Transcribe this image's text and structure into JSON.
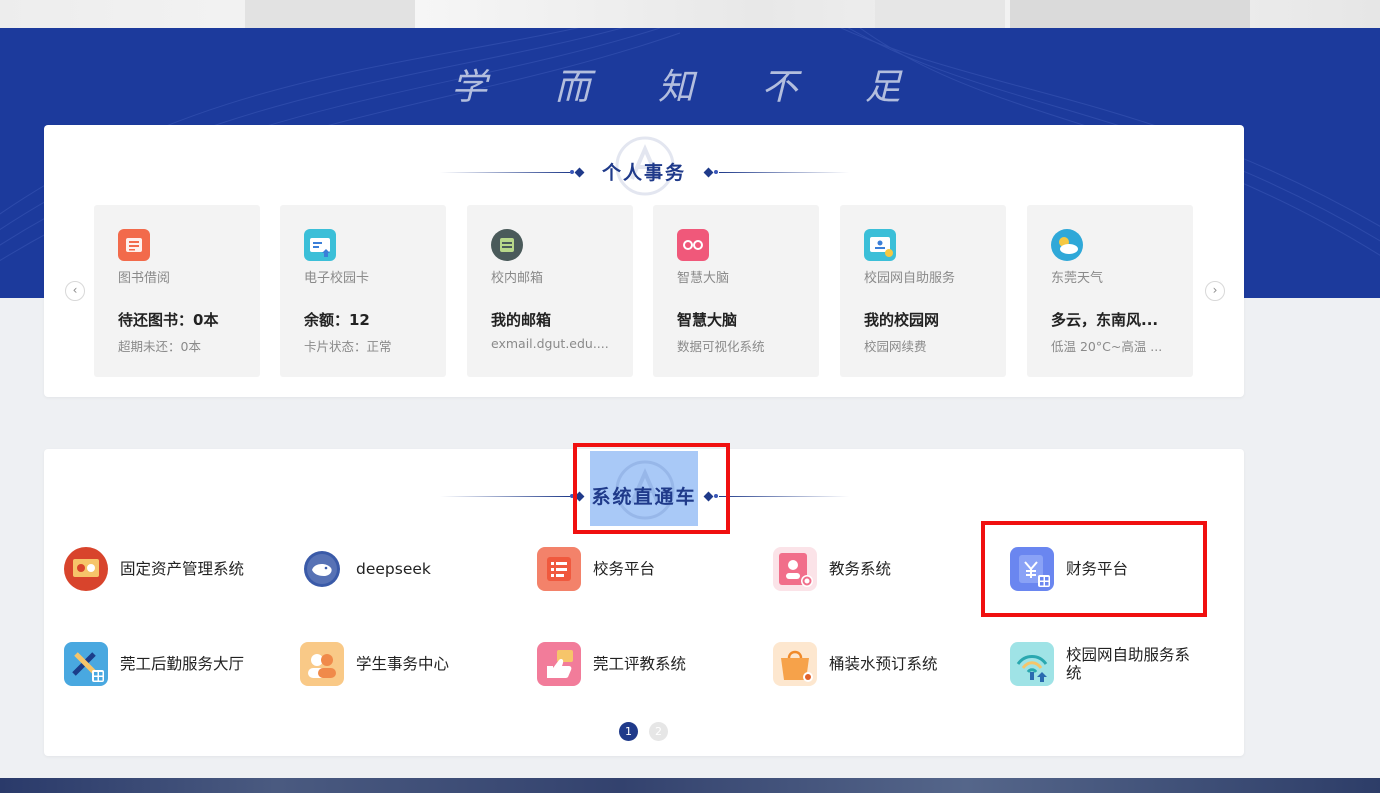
{
  "banner": {
    "motto": "学 而 知 不 足"
  },
  "personal": {
    "title": "个人事务",
    "tiles": [
      {
        "name": "图书借阅",
        "main": "待还图书：0本",
        "sub": "超期未还：0本",
        "icon": "book-list-icon",
        "color": "#f26a4b"
      },
      {
        "name": "电子校园卡",
        "main": "余额：12",
        "sub": "卡片状态：正常",
        "icon": "campus-card-icon",
        "color": "#3bbfd8"
      },
      {
        "name": "校内邮箱",
        "main": "我的邮箱",
        "sub": "exmail.dgut.edu....",
        "icon": "mailbox-icon",
        "color": "#4a5a5a"
      },
      {
        "name": "智慧大脑",
        "main": "智慧大脑",
        "sub": "数据可视化系统",
        "icon": "smart-glasses-icon",
        "color": "#f0587a"
      },
      {
        "name": "校园网自助服务",
        "main": "我的校园网",
        "sub": "校园网续费",
        "icon": "network-service-icon",
        "color": "#3bbfd8"
      },
      {
        "name": "东莞天气",
        "main": "多云，东南风...",
        "sub": "低温 20°C~高温 ...",
        "icon": "weather-cloud-icon",
        "color": "#2fa8d8"
      }
    ]
  },
  "systems": {
    "title": "系统直通车",
    "items": [
      {
        "label": "固定资产管理系统",
        "icon": "asset-management-icon",
        "color": "#d8442c"
      },
      {
        "label": "deepseek",
        "icon": "deepseek-whale-icon",
        "color": "#3a5aa8"
      },
      {
        "label": "校务平台",
        "icon": "school-affairs-icon",
        "color": "#f3826a"
      },
      {
        "label": "教务系统",
        "icon": "academic-system-icon",
        "color": "#f16e8a"
      },
      {
        "label": "财务平台",
        "icon": "finance-yuan-icon",
        "color": "#6a86f0"
      },
      {
        "label": "莞工后勤服务大厅",
        "icon": "logistics-tools-icon",
        "color": "#49a8e0"
      },
      {
        "label": "学生事务中心",
        "icon": "student-affairs-icon",
        "color": "#f6b26b"
      },
      {
        "label": "莞工评教系统",
        "icon": "teaching-evaluation-icon",
        "color": "#f27c9a"
      },
      {
        "label": "桶装水预订系统",
        "icon": "water-order-bag-icon",
        "color": "#f6a24a"
      },
      {
        "label": "校园网自助服务系统",
        "icon": "campus-wifi-icon",
        "color": "#3cc2c8"
      }
    ],
    "pages": [
      "1",
      "2"
    ],
    "active_page": "1"
  }
}
